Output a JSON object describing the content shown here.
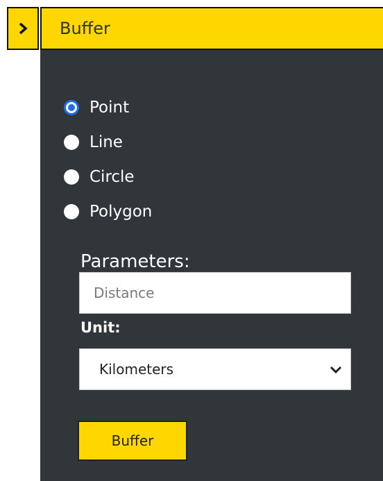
{
  "header": {
    "title": "Buffer",
    "toggle_icon": "chevron-right-icon"
  },
  "geometry_options": [
    {
      "label": "Point",
      "checked": true
    },
    {
      "label": "Line",
      "checked": false
    },
    {
      "label": "Circle",
      "checked": false
    },
    {
      "label": "Polygon",
      "checked": false
    }
  ],
  "parameters": {
    "title": "Parameters:",
    "distance_value": "",
    "distance_placeholder": "Distance",
    "unit_label": "Unit:",
    "unit_selected": "Kilometers"
  },
  "actions": {
    "buffer_label": "Buffer"
  },
  "colors": {
    "accent": "#FFD700",
    "panel_bg": "#31363A",
    "radio_checked": "#1E6FE8"
  }
}
